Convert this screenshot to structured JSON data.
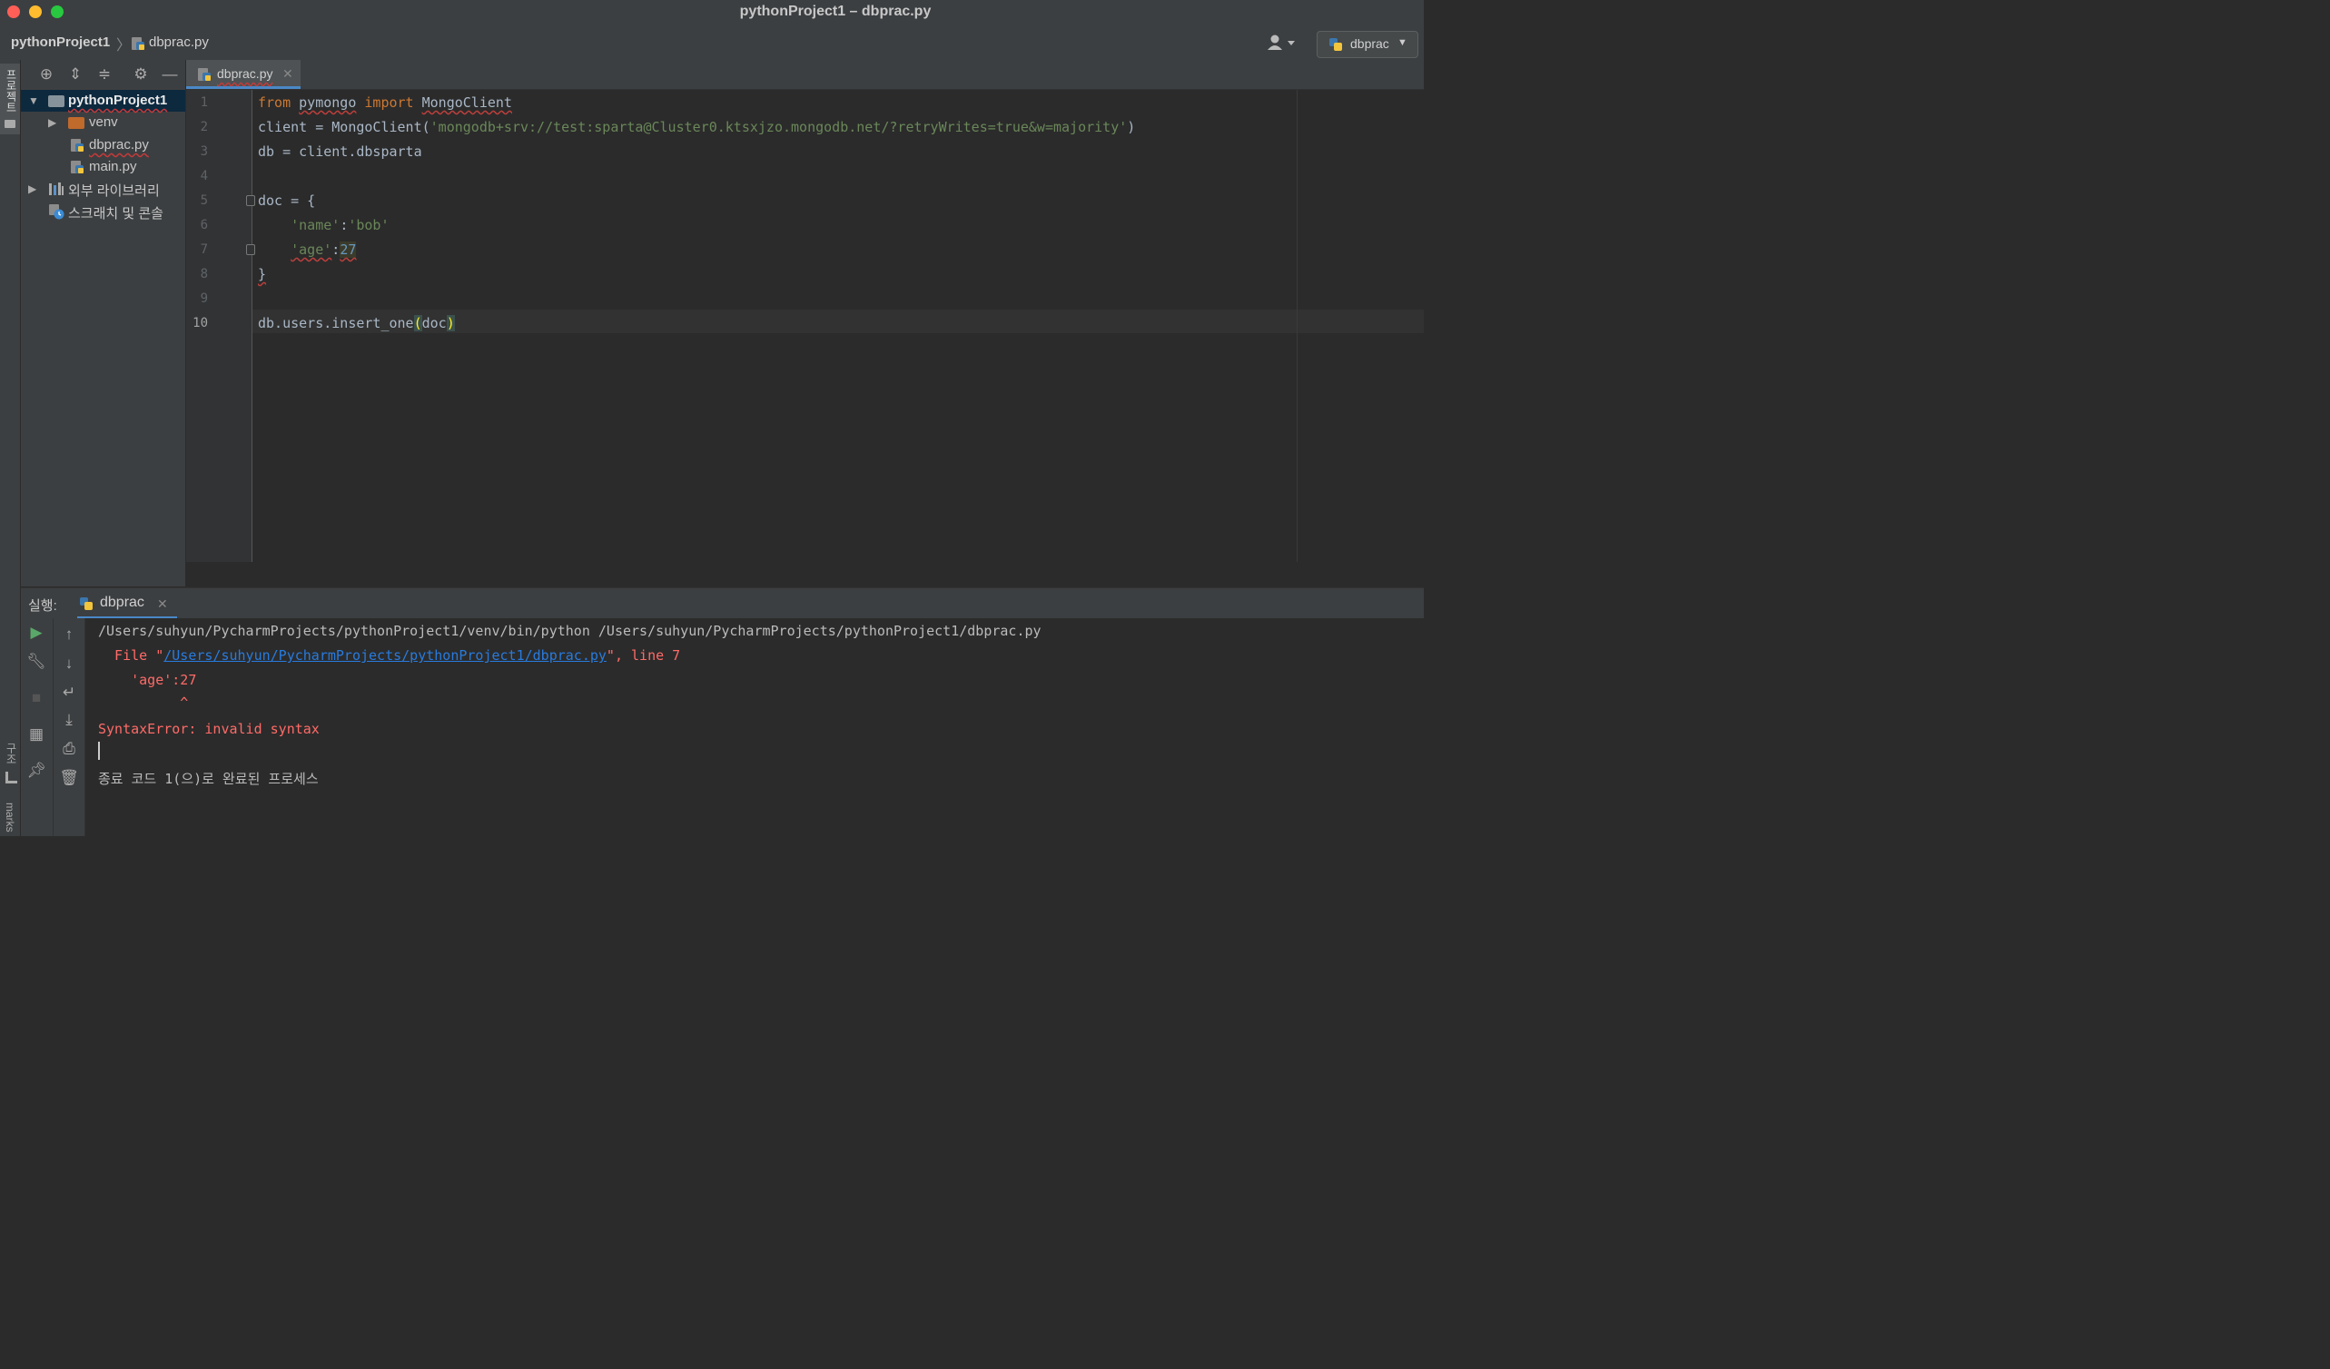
{
  "window": {
    "title": "pythonProject1 – dbprac.py"
  },
  "navbar": {
    "project": "pythonProject1",
    "file": "dbprac.py",
    "run_config": "dbprac"
  },
  "left_strip": {
    "project_label": "프로젝트",
    "structure_label": "구조",
    "bookmarks_label": "marks"
  },
  "project_tree": {
    "root": "pythonProject1",
    "items": [
      {
        "label": "venv"
      },
      {
        "label": "dbprac.py"
      },
      {
        "label": "main.py"
      },
      {
        "label": "외부 라이브러리"
      },
      {
        "label": "스크래치 및 콘솔"
      }
    ]
  },
  "editor": {
    "tab": "dbprac.py",
    "line_numbers": [
      "1",
      "2",
      "3",
      "4",
      "5",
      "6",
      "7",
      "8",
      "9",
      "10"
    ],
    "lines": {
      "l1": {
        "kw_from": "from",
        "mod": "pymongo",
        "kw_import": "import",
        "cls": "MongoClient"
      },
      "l2": {
        "pre": "client = MongoClient(",
        "str": "'mongodb+srv://test:sparta@Cluster0.ktsxjzo.mongodb.net/?retryWrites=true&w=majority'",
        "post": ")"
      },
      "l3": "db = client.dbsparta",
      "l5": "doc = {",
      "l6": {
        "key": "'name'",
        "colon": ":",
        "val": "'bob'"
      },
      "l7": {
        "key": "'age'",
        "colon": ":",
        "val": "27"
      },
      "l8": "}",
      "l10": {
        "pre": "db.users.insert_one",
        "open": "(",
        "arg": "doc",
        "close": ")"
      }
    }
  },
  "run": {
    "title": "실행:",
    "tab": "dbprac",
    "console": {
      "cmd": "/Users/suhyun/PycharmProjects/pythonProject1/venv/bin/python /Users/suhyun/PycharmProjects/pythonProject1/dbprac.py",
      "file_prefix": "  File \"",
      "file_link": "/Users/suhyun/PycharmProjects/pythonProject1/dbprac.py",
      "file_suffix": "\", line 7",
      "code_line": "    'age':27",
      "caret_line": "          ^",
      "error": "SyntaxError: invalid syntax",
      "exit": "종료 코드 1(으)로 완료된 프로세스"
    }
  }
}
